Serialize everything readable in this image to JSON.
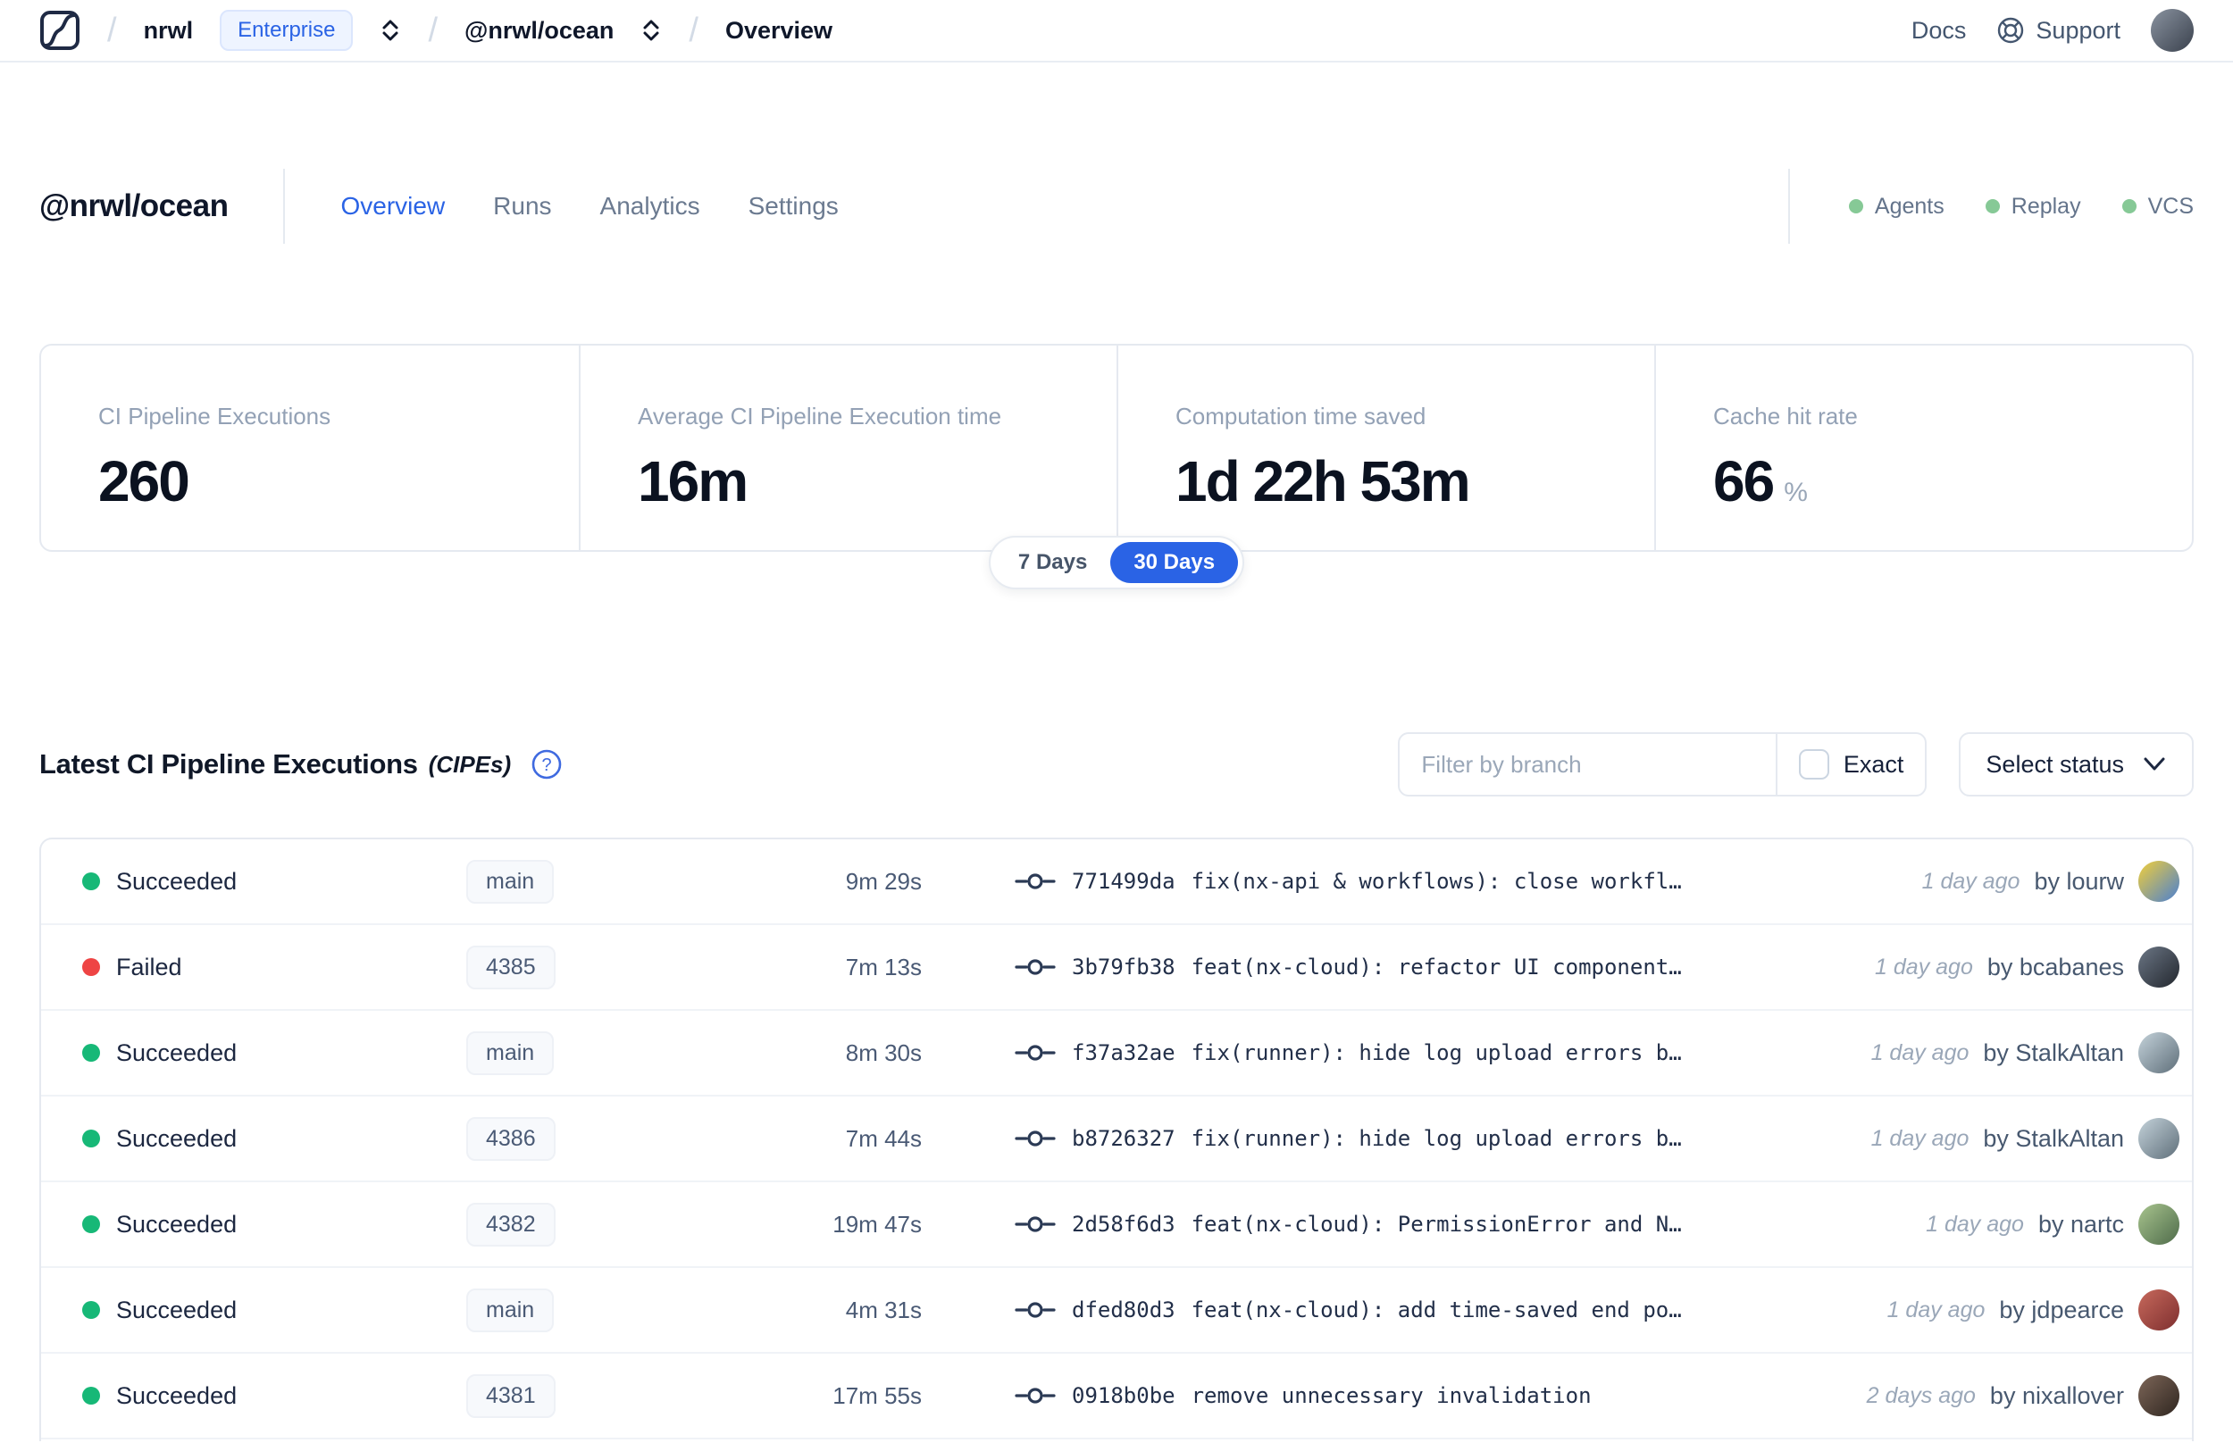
{
  "colors": {
    "accent_blue": "#2a63e5",
    "success_green": "#17b877",
    "failed_red": "#ee4444",
    "indicator_green": "#86c996"
  },
  "nav": {
    "breadcrumb": {
      "org": "nrwl",
      "org_badge": "Enterprise",
      "workspace": "@nrwl/ocean",
      "page": "Overview"
    },
    "docs_label": "Docs",
    "support_label": "Support",
    "avatar_gradient": [
      "#8a93a0",
      "#3a414d"
    ]
  },
  "header": {
    "title": "@nrwl/ocean",
    "tabs": [
      {
        "label": "Overview",
        "active": true
      },
      {
        "label": "Runs",
        "active": false
      },
      {
        "label": "Analytics",
        "active": false
      },
      {
        "label": "Settings",
        "active": false
      }
    ],
    "indicators": [
      {
        "label": "Agents"
      },
      {
        "label": "Replay"
      },
      {
        "label": "VCS"
      }
    ]
  },
  "stats": {
    "cards": [
      {
        "label": "CI Pipeline Executions",
        "value": "260",
        "unit": ""
      },
      {
        "label": "Average CI Pipeline Execution time",
        "value": "16m",
        "unit": ""
      },
      {
        "label": "Computation time saved",
        "value": "1d 22h 53m",
        "unit": ""
      },
      {
        "label": "Cache hit rate",
        "value": "66",
        "unit": "%"
      }
    ],
    "range_toggle": {
      "options": [
        "7 Days",
        "30 Days"
      ],
      "selected": "30 Days"
    }
  },
  "cipes": {
    "title": "Latest CI Pipeline Executions",
    "title_suffix": "(CIPEs)",
    "filter_placeholder": "Filter by branch",
    "exact_label": "Exact",
    "select_status_label": "Select status",
    "rows": [
      {
        "status": "Succeeded",
        "branch": "main",
        "duration": "9m 29s",
        "commit_hash": "771499da",
        "commit_message": "fix(nx-api & workflows): close workfl…",
        "time": "1 day ago",
        "author": "by lourw",
        "avatar_gradient": [
          "#f2cf3a",
          "#4a7fd1"
        ]
      },
      {
        "status": "Failed",
        "branch": "4385",
        "duration": "7m 13s",
        "commit_hash": "3b79fb38",
        "commit_message": "feat(nx-cloud): refactor UI component…",
        "time": "1 day ago",
        "author": "by bcabanes",
        "avatar_gradient": [
          "#6b7685",
          "#23272e"
        ]
      },
      {
        "status": "Succeeded",
        "branch": "main",
        "duration": "8m 30s",
        "commit_hash": "f37a32ae",
        "commit_message": "fix(runner): hide log upload errors b…",
        "time": "1 day ago",
        "author": "by StalkAltan",
        "avatar_gradient": [
          "#c4d2da",
          "#5f6f7a"
        ]
      },
      {
        "status": "Succeeded",
        "branch": "4386",
        "duration": "7m 44s",
        "commit_hash": "b8726327",
        "commit_message": "fix(runner): hide log upload errors b…",
        "time": "1 day ago",
        "author": "by StalkAltan",
        "avatar_gradient": [
          "#c4d2da",
          "#5f6f7a"
        ]
      },
      {
        "status": "Succeeded",
        "branch": "4382",
        "duration": "19m 47s",
        "commit_hash": "2d58f6d3",
        "commit_message": "feat(nx-cloud): PermissionError and N…",
        "time": "1 day ago",
        "author": "by nartc",
        "avatar_gradient": [
          "#a8c48e",
          "#4e6b4a"
        ]
      },
      {
        "status": "Succeeded",
        "branch": "main",
        "duration": "4m 31s",
        "commit_hash": "dfed80d3",
        "commit_message": "feat(nx-cloud): add time-saved end po…",
        "time": "1 day ago",
        "author": "by jdpearce",
        "avatar_gradient": [
          "#c7695c",
          "#7e2f2f"
        ]
      },
      {
        "status": "Succeeded",
        "branch": "4381",
        "duration": "17m 55s",
        "commit_hash": "0918b0be",
        "commit_message": "remove unnecessary invalidation",
        "time": "2 days ago",
        "author": "by nixallover",
        "avatar_gradient": [
          "#7d6658",
          "#2f2620"
        ]
      }
    ]
  }
}
